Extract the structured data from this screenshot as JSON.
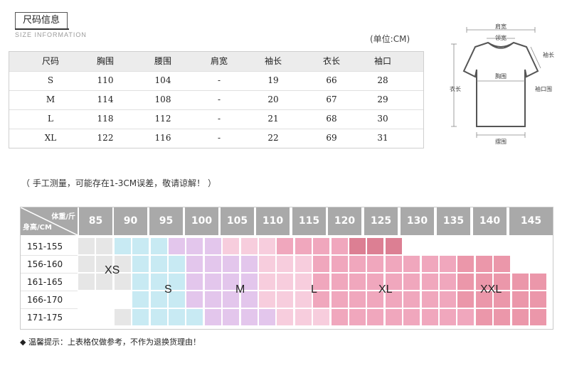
{
  "header": {
    "title": "尺码信息",
    "subtitle": "SIZE INFORMATION",
    "unit": "(单位:CM)"
  },
  "size_table": {
    "columns": [
      "尺码",
      "胸围",
      "腰围",
      "肩宽",
      "袖长",
      "衣长",
      "袖口"
    ],
    "rows": [
      [
        "S",
        "110",
        "104",
        "-",
        "19",
        "66",
        "28"
      ],
      [
        "M",
        "114",
        "108",
        "-",
        "20",
        "67",
        "29"
      ],
      [
        "L",
        "118",
        "112",
        "-",
        "21",
        "68",
        "30"
      ],
      [
        "XL",
        "122",
        "116",
        "-",
        "22",
        "69",
        "31"
      ]
    ]
  },
  "diagram": {
    "labels": {
      "shoulder": "肩宽",
      "collar": "领宽",
      "sleeve": "袖长",
      "chest": "胸围",
      "length": "衣长",
      "cuff": "袖口围",
      "hem": "摆围"
    }
  },
  "note": "（ 手工测量，可能存在1-3CM误差，敬请谅解！ ）",
  "fit_chart": {
    "corner_weight": "体重/斤",
    "corner_height": "身高/CM",
    "weights": [
      "85",
      "90",
      "95",
      "100",
      "105",
      "110",
      "115",
      "120",
      "125",
      "130",
      "135",
      "140",
      "145"
    ],
    "heights": [
      "151-155",
      "156-160",
      "161-165",
      "166-170",
      "171-175"
    ],
    "size_labels": [
      "XS",
      "S",
      "M",
      "L",
      "XL",
      "XXL"
    ],
    "colors": {
      "XS": "#e6e6e6",
      "S": "#c8eaf3",
      "M": "#e3c6ec",
      "L": "#f7cddd",
      "XL": "#f0a7bd",
      "XXL": "#eb97aa",
      "DARK": "#dc7f93",
      "header": "#a9a9a9"
    }
  },
  "bottom_note": "温馨提示：上表格仅做参考，不作为退换货理由！"
}
